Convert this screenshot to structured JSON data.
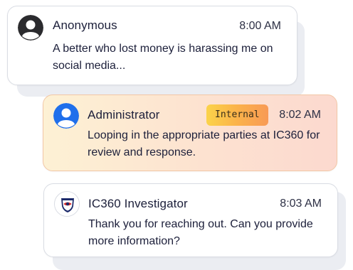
{
  "messages": [
    {
      "author": "Anonymous",
      "time": "8:00 AM",
      "text": "A better who lost money is harassing me on social media...",
      "avatar_icon": "user-silhouette-icon",
      "avatar_color": "#2b2b2e"
    },
    {
      "author": "Administrator",
      "time": "8:02 AM",
      "text": "Looping in the appropriate parties at IC360 for review and response.",
      "badge": "Internal",
      "avatar_icon": "user-silhouette-icon",
      "avatar_color": "#1f6feb"
    },
    {
      "author": "IC360 Investigator",
      "time": "8:03 AM",
      "text": "Thank you for reaching out. Can you provide more information?",
      "avatar_icon": "ic360-shield-logo-icon",
      "avatar_color": "#1c2a6b"
    }
  ],
  "colors": {
    "internal_gradient_start": "#fdf1d4",
    "internal_gradient_end": "#fcd9cf",
    "badge_gradient_start": "#fbd34a",
    "badge_gradient_end": "#f89a55"
  }
}
